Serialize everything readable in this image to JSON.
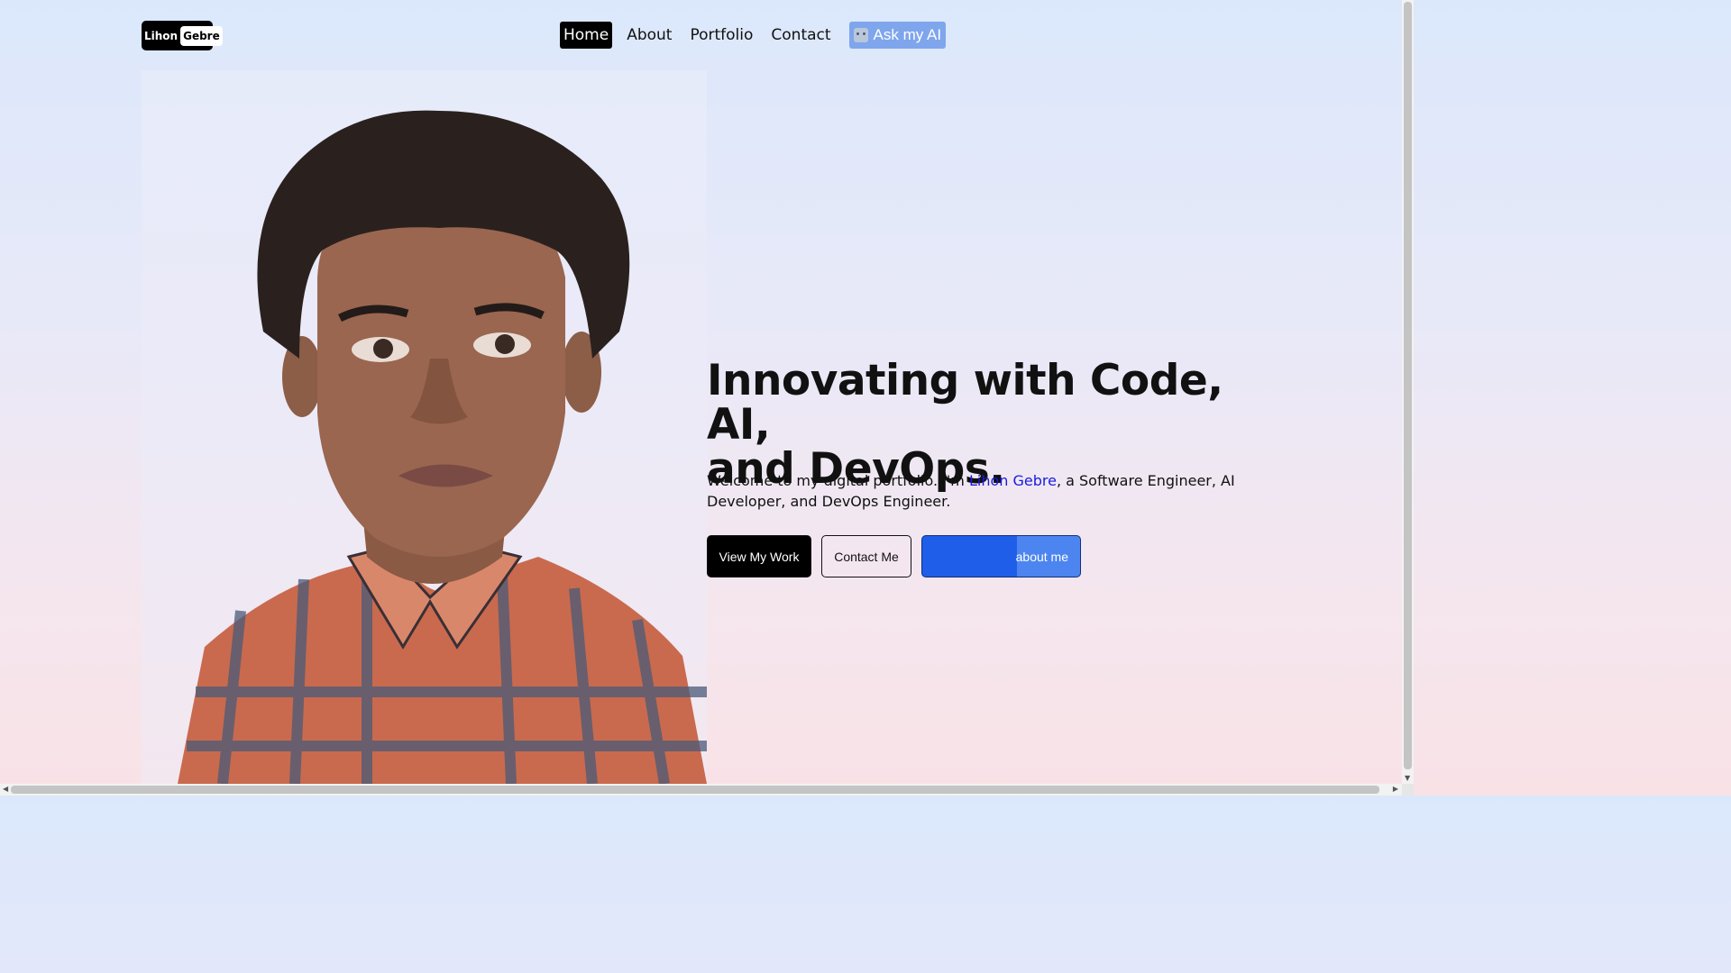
{
  "header": {
    "logo": {
      "part1": "Lihon",
      "part2": "Gebre"
    },
    "nav": [
      {
        "label": "Home",
        "active": true
      },
      {
        "label": "About"
      },
      {
        "label": "Portfolio"
      },
      {
        "label": "Contact"
      }
    ],
    "ai_button": {
      "label": "Ask my AI",
      "icon": "robot-icon"
    }
  },
  "hero": {
    "title_line1": "Innovating with Code, AI,",
    "title_line2": "and DevOps.",
    "subtitle_pre": "Welcome to my digital portfolio. I'm ",
    "subtitle_name": "Lihon Gebre",
    "subtitle_post": ", a Software Engineer, AI Developer, and DevOps Engineer.",
    "buttons": {
      "primary": "View My Work",
      "secondary": "Contact Me",
      "ai": "about me"
    },
    "portrait_alt": "portrait illustration"
  },
  "colors": {
    "accent_blue": "#1f5ee8",
    "name_link": "#1a1adf",
    "dark": "#000000"
  }
}
